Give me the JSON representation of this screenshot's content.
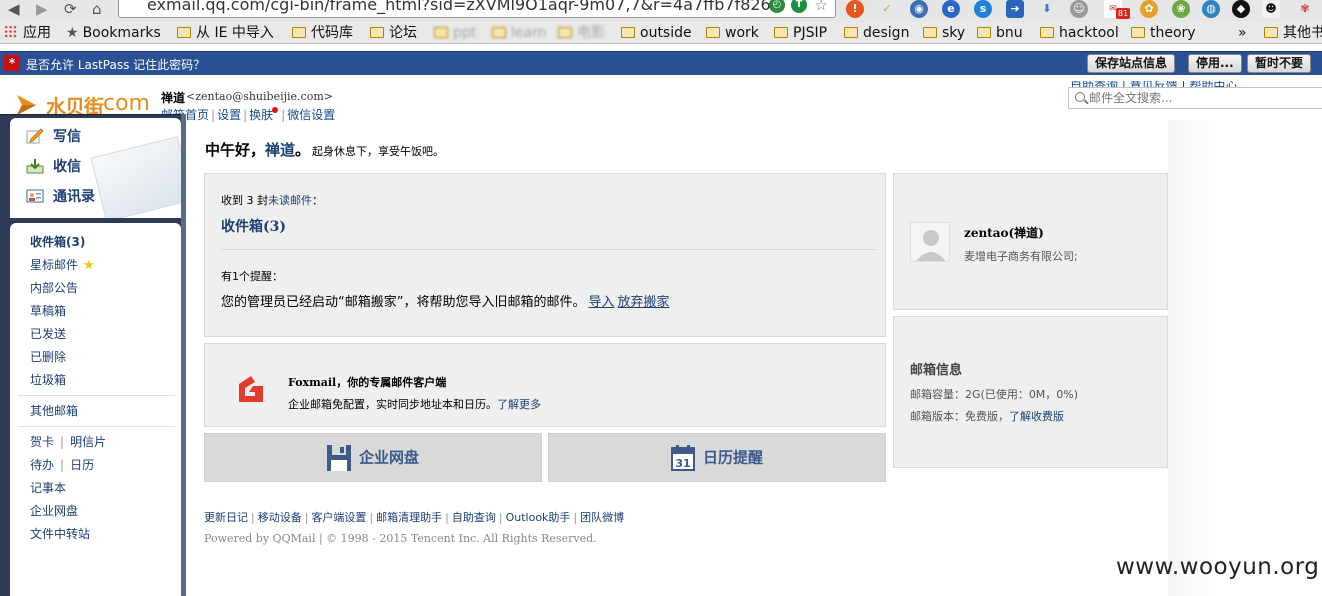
{
  "browser": {
    "url": "exmail.qq.com/cgi-bin/frame_html?sid=zXVMl9O1aqr-9m07,7&r=4a7ffb7f82693d1632a",
    "ext_badge": "81",
    "bookmarks": [
      {
        "label": "应用",
        "type": "apps"
      },
      {
        "label": "Bookmarks",
        "type": "star"
      },
      {
        "label": "从 IE 中导入",
        "type": "folder"
      },
      {
        "label": "代码库",
        "type": "folder"
      },
      {
        "label": "论坛",
        "type": "folder"
      },
      {
        "label": "ppt",
        "type": "folder"
      },
      {
        "label": "learn",
        "type": "folder"
      },
      {
        "label": "电影",
        "type": "folder"
      },
      {
        "label": "outside",
        "type": "folder"
      },
      {
        "label": "work",
        "type": "folder"
      },
      {
        "label": "PJSIP",
        "type": "folder"
      },
      {
        "label": "design",
        "type": "folder"
      },
      {
        "label": "sky",
        "type": "folder"
      },
      {
        "label": "bnu",
        "type": "folder"
      },
      {
        "label": "hacktool",
        "type": "folder"
      },
      {
        "label": "theory",
        "type": "folder"
      },
      {
        "label": "»",
        "type": "more"
      },
      {
        "label": "其他书",
        "type": "folder"
      }
    ]
  },
  "lastpass": {
    "logo": "*",
    "prompt": "是否允许 LastPass 记住此密码？",
    "btn_save": "保存站点信息",
    "btn_disable": "停用...",
    "btn_later": "暂时不要"
  },
  "header": {
    "logo_cn": "水贝街",
    "logo_com": ".com",
    "user_name": "禅道",
    "user_email": "<zentao@shuibeijie.com>",
    "links": [
      "邮箱首页",
      "设置",
      "换肤",
      "微信设置"
    ],
    "right_links": "自助查询 | 意见反馈 | 帮助中心",
    "search_placeholder": "邮件全文搜索..."
  },
  "sidebar": {
    "quick": [
      "写信",
      "收信",
      "通讯录"
    ],
    "folders": [
      "收件箱(3)",
      "星标邮件",
      "内部公告",
      "草稿箱",
      "已发送",
      "已删除",
      "垃圾箱"
    ],
    "other": "其他邮箱",
    "extra": {
      "card": "贺卡",
      "postcard": "明信片",
      "todo": "待办",
      "calendar": "日历"
    },
    "tools": [
      "记事本",
      "企业网盘",
      "文件中转站"
    ]
  },
  "main": {
    "greet_hello": "中午好，",
    "greet_name": "禅道",
    "greet_end": "。",
    "greet_sub": "起身休息下，享受午饭吧。",
    "recv_prefix": "收到 3 封",
    "recv_unread": "未读邮件",
    "recv_suffix": "：",
    "inbox_link": "收件箱(3)",
    "remind_title": "有1个提醒：",
    "remind_body": "您的管理员已经启动“邮箱搬家”，将帮助您导入旧邮箱的邮件。",
    "remind_import": "导入",
    "remind_cancel": "放弃搬家",
    "foxmail_title": "Foxmail，你的专属邮件客户端",
    "foxmail_desc": "企业邮箱免配置，实时同步地址本和日历。",
    "foxmail_more": "了解更多",
    "tile_disk": "企业网盘",
    "tile_calendar": "日历提醒",
    "calendar_day": "31"
  },
  "profile": {
    "name": "zentao(禅道)",
    "company": "麦增电子商务有限公司;"
  },
  "mailbox": {
    "title": "邮箱信息",
    "capacity": "邮箱容量：2G(已使用：0M，0%)",
    "version_prefix": "邮箱版本：免费版，",
    "version_link": "了解收费版"
  },
  "footer": {
    "links": [
      "更新日记",
      "移动设备",
      "客户端设置",
      "邮箱清理助手",
      "自助查询",
      "Outlook助手",
      "团队微博"
    ],
    "copyright": "Powered by QQMail  | © 1998 - 2015 Tencent Inc. All Rights Reserved."
  },
  "watermark": "www.wooyun.org",
  "colors": {
    "link_blue": "#1d3f74",
    "lastpass_bar": "#2a5195",
    "logo_orange": "#e98d1e",
    "foxmail_red": "#e23b2e"
  }
}
